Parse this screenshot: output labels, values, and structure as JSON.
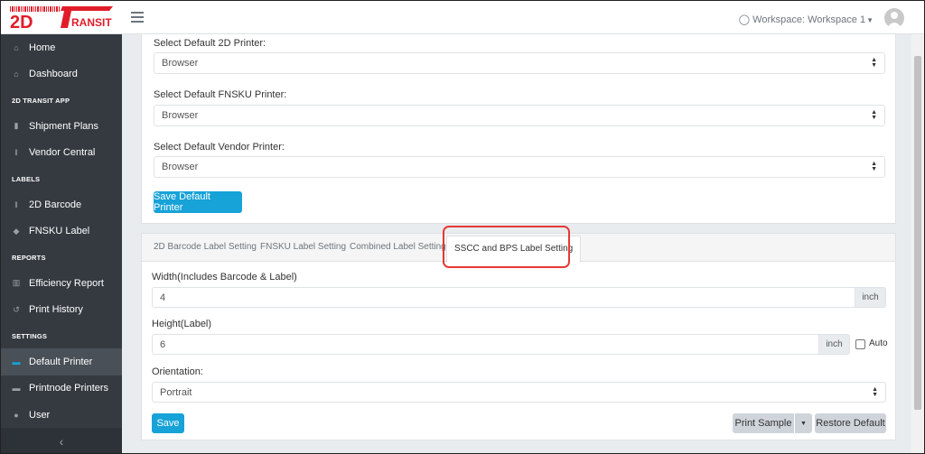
{
  "brand": {
    "logo_text": "2DTRANSIT",
    "colors": {
      "accent": "#17a2d8",
      "logo": "#e11d2a",
      "sidebar": "#343a40",
      "highlight": "#e53935"
    }
  },
  "header": {
    "workspace_label": "Workspace: Workspace 1",
    "workspace_icon": "user-outline-icon"
  },
  "sidebar": {
    "items": [
      {
        "label": "Home",
        "icon": "home-icon"
      },
      {
        "label": "Dashboard",
        "icon": "dashboard-icon"
      },
      {
        "heading": "2D TRANSIT APP"
      },
      {
        "label": "Shipment Plans",
        "icon": "truck-icon"
      },
      {
        "label": "Vendor Central",
        "icon": "barcode-icon"
      },
      {
        "heading": "LABELS"
      },
      {
        "label": "2D Barcode",
        "icon": "barcode-icon"
      },
      {
        "label": "FNSKU Label",
        "icon": "tag-icon"
      },
      {
        "heading": "REPORTS"
      },
      {
        "label": "Efficiency Report",
        "icon": "bar-chart-icon"
      },
      {
        "label": "Print History",
        "icon": "history-icon"
      },
      {
        "heading": "SETTINGS"
      },
      {
        "label": "Default Printer",
        "icon": "printer-icon",
        "active": true
      },
      {
        "label": "Printnode Printers",
        "icon": "printer-icon"
      },
      {
        "label": "User",
        "icon": "user-icon"
      }
    ],
    "collapse_glyph": "‹"
  },
  "printers": {
    "label_2d": "Select Default 2D Printer:",
    "value_2d": "Browser",
    "label_fnsku": "Select Default FNSKU Printer:",
    "value_fnsku": "Browser",
    "label_vendor": "Select Default Vendor Printer:",
    "value_vendor": "Browser",
    "save_button": "Save Default Printer"
  },
  "label_settings": {
    "tabs": [
      {
        "label": "2D Barcode Label Setting"
      },
      {
        "label": "FNSKU Label Setting"
      },
      {
        "label": "Combined Label Setting"
      },
      {
        "label": "SSCC and BPS Label Setting",
        "active": true
      }
    ],
    "width_label": "Width(Includes Barcode & Label)",
    "width_value": "4",
    "width_unit": "inch",
    "height_label": "Height(Label)",
    "height_value": "6",
    "height_unit": "inch",
    "auto_label": "Auto",
    "auto_checked": false,
    "orientation_label": "Orientation:",
    "orientation_value": "Portrait",
    "save_button": "Save",
    "print_sample_button": "Print Sample",
    "restore_button": "Restore Default"
  }
}
